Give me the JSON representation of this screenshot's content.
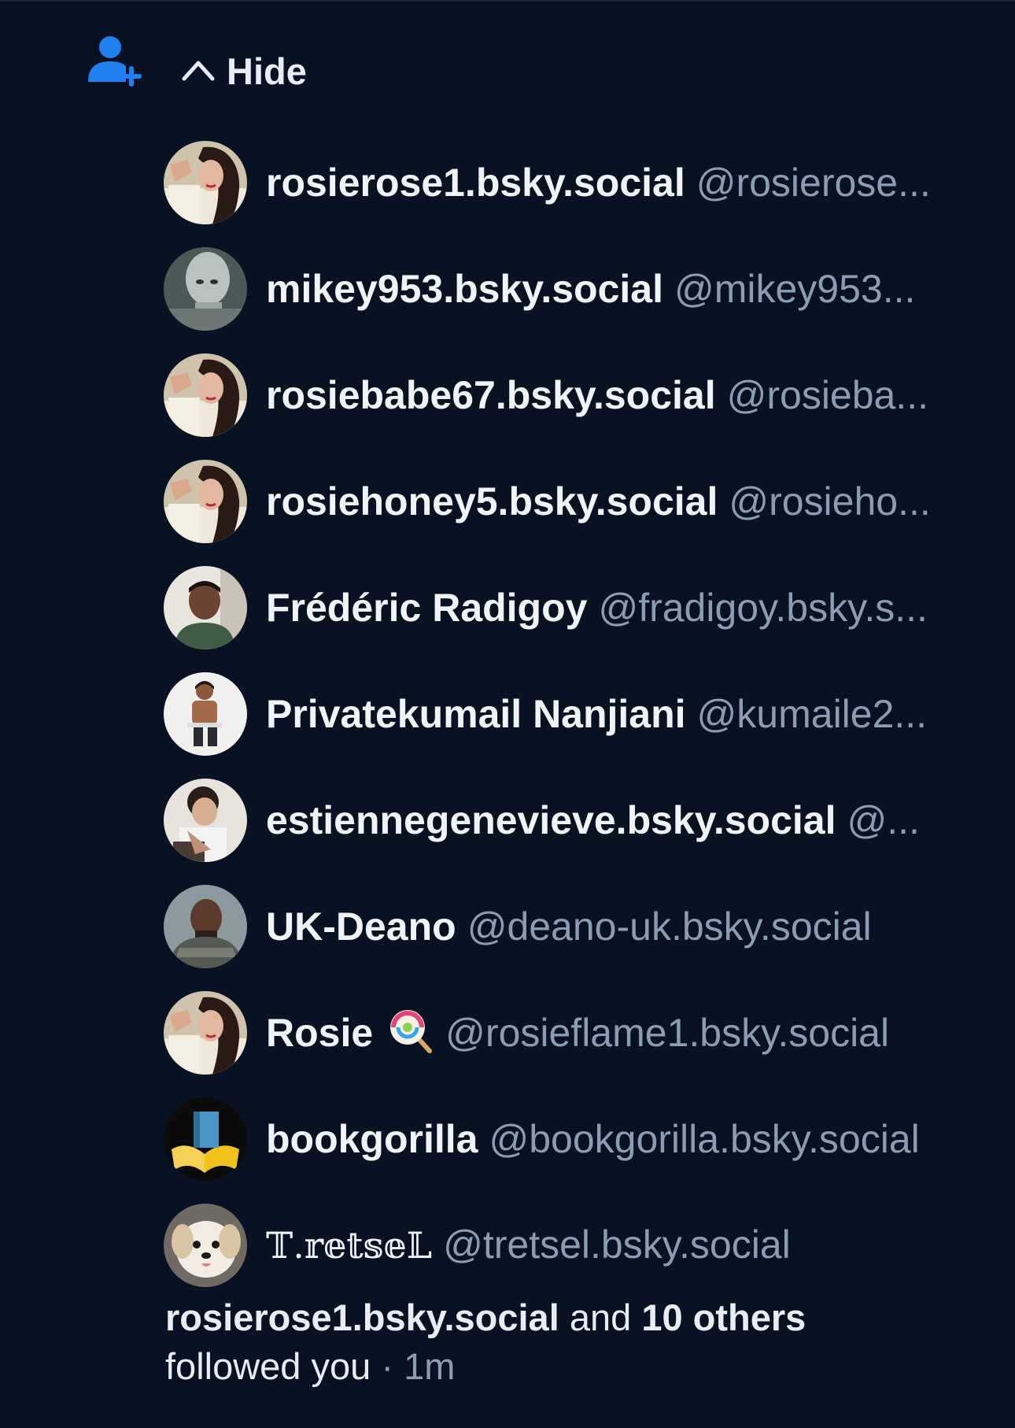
{
  "header": {
    "toggle_label": "Hide",
    "icon": "person-add-icon",
    "accent_color": "#1f80f2"
  },
  "followers": [
    {
      "display_name": "rosierose1.bsky.social",
      "handle": "@rosierose...",
      "avatar": "avatar-woman"
    },
    {
      "display_name": "mikey953.bsky.social",
      "handle": "@mikey953...",
      "avatar": "avatar-alien"
    },
    {
      "display_name": "rosiebabe67.bsky.social",
      "handle": "@rosieba...",
      "avatar": "avatar-woman"
    },
    {
      "display_name": "rosiehoney5.bsky.social",
      "handle": "@rosieho...",
      "avatar": "avatar-woman"
    },
    {
      "display_name": "Frédéric Radigoy",
      "handle": "@fradigoy.bsky.s...",
      "avatar": "avatar-man-green"
    },
    {
      "display_name": "Privatekumail Nanjiani",
      "handle": "@kumaile2...",
      "avatar": "avatar-man-seated"
    },
    {
      "display_name": "estiennegenevieve.bsky.social",
      "handle": "@...",
      "avatar": "avatar-man-curly"
    },
    {
      "display_name": "UK-Deano",
      "handle": "@deano-uk.bsky.social",
      "avatar": "avatar-warrior"
    },
    {
      "display_name": "Rosie",
      "handle": "@rosieflame1.bsky.social",
      "avatar": "avatar-woman",
      "emoji": "lollipop-icon"
    },
    {
      "display_name": "bookgorilla",
      "handle": "@bookgorilla.bsky.social",
      "avatar": "avatar-book-logo"
    },
    {
      "display_name": "𝕋.𝕣𝕖𝕥𝕤𝕖𝕃",
      "handle": "@tretsel.bsky.social",
      "avatar": "avatar-dog"
    }
  ],
  "summary": {
    "actor": "rosierose1.bsky.social",
    "and": "and",
    "others": "10 others",
    "action": "followed you",
    "separator": "·",
    "time": "1m"
  },
  "colors": {
    "background": "#081222",
    "name": "#f0f3f7",
    "handle": "#8a9db3"
  }
}
